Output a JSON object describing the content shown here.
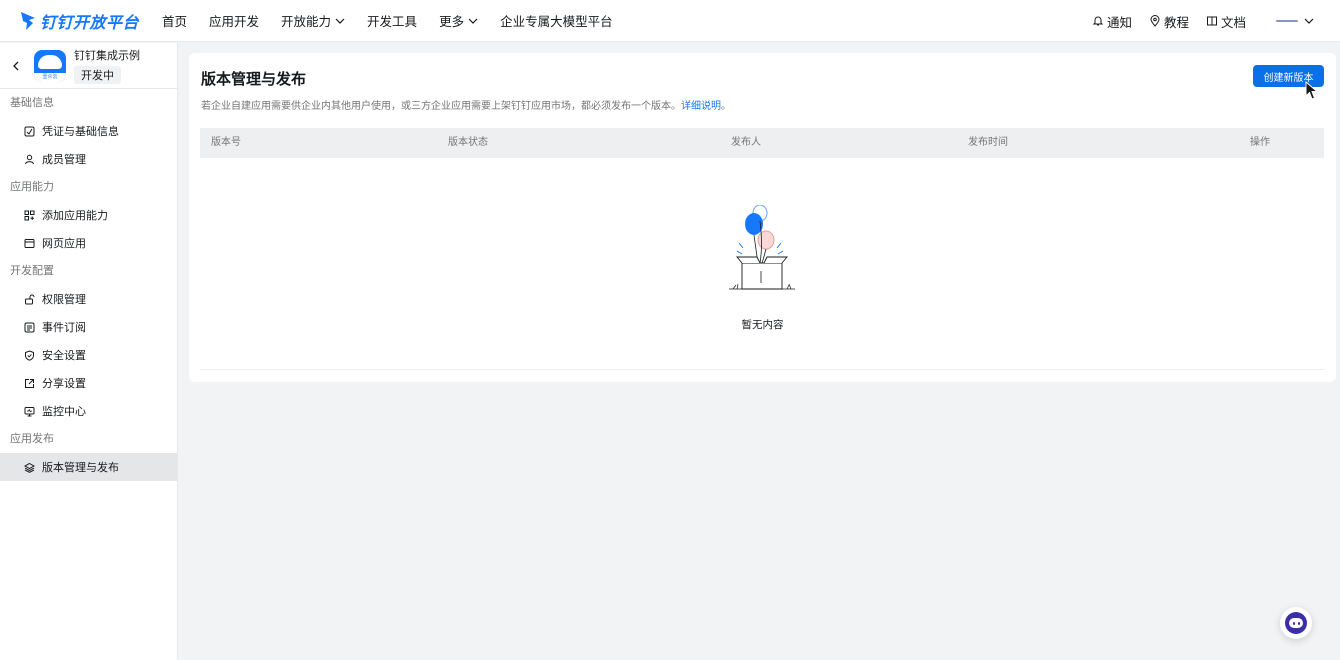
{
  "brand": {
    "name": "钉钉开放平台",
    "color": "#1677ff"
  },
  "topnav": {
    "items": [
      {
        "label": "首页",
        "dropdown": false
      },
      {
        "label": "应用开发",
        "dropdown": false
      },
      {
        "label": "开放能力",
        "dropdown": true
      },
      {
        "label": "开发工具",
        "dropdown": false
      },
      {
        "label": "更多",
        "dropdown": true
      },
      {
        "label": "企业专属大模型平台",
        "dropdown": false
      }
    ],
    "right": [
      {
        "label": "通知",
        "icon": "bell-icon"
      },
      {
        "label": "教程",
        "icon": "location-pin-icon"
      },
      {
        "label": "文档",
        "icon": "book-icon"
      }
    ]
  },
  "sidebar": {
    "app": {
      "name": "钉钉集成示例",
      "status": "开发中"
    },
    "groups": [
      {
        "label": "基础信息",
        "items": [
          {
            "label": "凭证与基础信息",
            "icon": "credential-icon"
          },
          {
            "label": "成员管理",
            "icon": "user-icon"
          }
        ]
      },
      {
        "label": "应用能力",
        "items": [
          {
            "label": "添加应用能力",
            "icon": "grid-add-icon"
          },
          {
            "label": "网页应用",
            "icon": "browser-icon"
          }
        ]
      },
      {
        "label": "开发配置",
        "items": [
          {
            "label": "权限管理",
            "icon": "unlock-icon"
          },
          {
            "label": "事件订阅",
            "icon": "subscription-icon"
          },
          {
            "label": "安全设置",
            "icon": "shield-icon"
          },
          {
            "label": "分享设置",
            "icon": "share-icon"
          },
          {
            "label": "监控中心",
            "icon": "monitor-icon"
          }
        ]
      },
      {
        "label": "应用发布",
        "items": [
          {
            "label": "版本管理与发布",
            "icon": "layers-icon",
            "active": true
          }
        ]
      }
    ]
  },
  "main": {
    "title": "版本管理与发布",
    "description": "若企业自建应用需要供企业内其他用户使用，或三方企业应用需要上架钉钉应用市场，都必须发布一个版本。",
    "description_link": "详细说明",
    "description_end": "。",
    "create_button": "创建新版本",
    "table": {
      "columns": [
        "版本号",
        "版本状态",
        "发布人",
        "发布时间",
        "操作"
      ],
      "rows": []
    },
    "empty_text": "暂无内容"
  },
  "colors": {
    "primary_button": "#0b6fe8",
    "active_item_bg": "#e5e6e8",
    "page_bg": "#f2f3f5"
  }
}
